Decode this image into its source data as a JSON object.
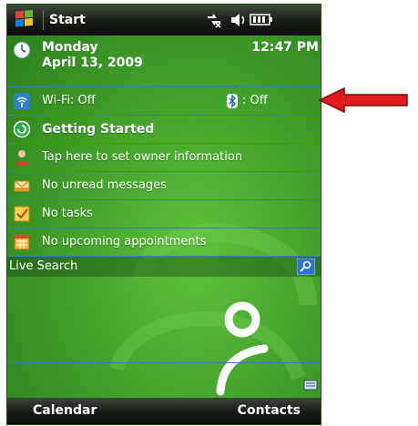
{
  "titlebar": {
    "title": "Start"
  },
  "date_row": {
    "day": "Monday",
    "date": "April 13, 2009",
    "time": "12:47 PM"
  },
  "wireless_row": {
    "wifi": "Wi-Fi: Off",
    "bluetooth": ": Off"
  },
  "items": [
    {
      "label": "Getting Started",
      "icon": "getting-started-icon"
    },
    {
      "label": "Tap here to set owner information",
      "icon": "owner-icon"
    },
    {
      "label": "No unread messages",
      "icon": "messages-icon"
    },
    {
      "label": "No tasks",
      "icon": "tasks-icon"
    },
    {
      "label": "No upcoming appointments",
      "icon": "calendar-icon"
    }
  ],
  "search": {
    "label": "Live Search"
  },
  "softkeys": {
    "left": "Calendar",
    "right": "Contacts"
  },
  "colors": {
    "screen_green": "#3a9a26",
    "row_separator": "#2f7ec0",
    "arrow_red": "#e11b1b"
  }
}
